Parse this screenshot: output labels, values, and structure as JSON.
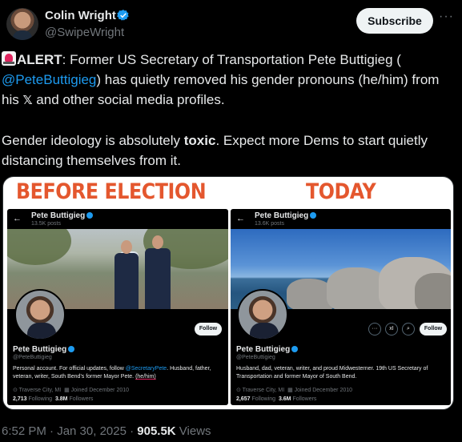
{
  "author": {
    "name": "Colin Wright",
    "handle": "@SwipeWright"
  },
  "actions": {
    "subscribe_label": "Subscribe",
    "more_label": "···"
  },
  "tweet": {
    "alert_word": "ALERT",
    "text_part1": ": Former US Secretary of Transportation Pete Buttigieg (",
    "mention": "@PeteButtigieg",
    "text_part2": ") has quietly removed his gender pronouns (he/him) from his ",
    "x_symbol": "𝕏",
    "text_part3": " and other social media profiles.",
    "para2_start": "Gender ideology is absolutely ",
    "para2_bold": "toxic",
    "para2_end": ". Expect more Dems to start quietly distancing themselves from it."
  },
  "media": {
    "label_before": "BEFORE ELECTION",
    "label_today": "TODAY",
    "before": {
      "back": "←",
      "top_name": "Pete Buttigieg",
      "posts": "13.5K posts",
      "follow": "Follow",
      "name": "Pete Buttigieg",
      "handle": "@PeteButtigieg",
      "bio_part1": "Personal account. For official updates, follow ",
      "bio_mention": "@SecretaryPete",
      "bio_part2": ". Husband, father, veteran, writer, South Bend's former Mayor Pete. ",
      "bio_pronouns": "(he/him)",
      "location": "⊙ Traverse City, MI",
      "joined": "▦ Joined December 2010",
      "following_count": "2,713",
      "following_label": "Following",
      "followers_count": "3.8M",
      "followers_label": "Followers"
    },
    "today": {
      "back": "←",
      "top_name": "Pete Buttigieg",
      "posts": "13.6K posts",
      "follow": "Follow",
      "btn_more": "···",
      "btn_grok": "xI",
      "btn_search": "⌕",
      "name": "Pete Buttigieg",
      "handle": "@PeteButtigieg",
      "bio": "Husband, dad, veteran, writer, and proud Midwesterner. 19th US Secretary of Transportation and former Mayor of South Bend.",
      "location": "⊙ Traverse City, MI",
      "joined": "▦ Joined December 2010",
      "following_count": "2,657",
      "following_label": "Following",
      "followers_count": "3.6M",
      "followers_label": "Followers"
    }
  },
  "footer": {
    "time": "6:52 PM · Jan 30, 2025 · ",
    "views_count": "905.5K",
    "views_label": " Views"
  },
  "colors": {
    "accent": "#1d9bf0",
    "label_red": "#e4572e",
    "background": "#000000",
    "text": "#e7e9ea",
    "muted": "#71767b"
  }
}
